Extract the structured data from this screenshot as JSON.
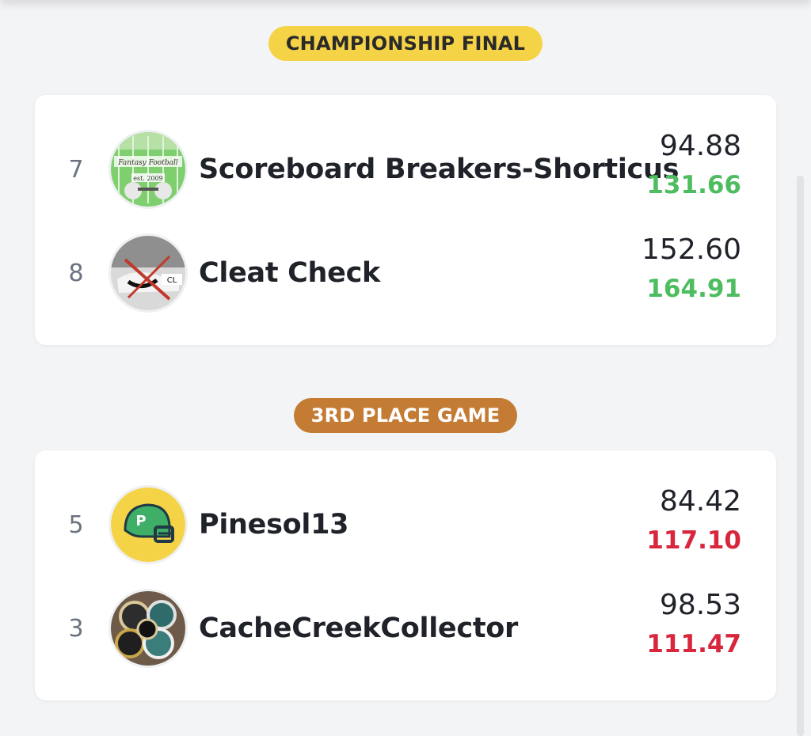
{
  "colors": {
    "background": "#f3f4f6",
    "championship_pill": "#f5d347",
    "third_place_pill": "#c47c35",
    "win_score": "#4dbd5f",
    "loss_score": "#d8263d"
  },
  "championship": {
    "label": "CHAMPIONSHIP FINAL",
    "teams": [
      {
        "seed": "7",
        "name": "Scoreboard Breakers-Shorticus",
        "score_top": "94.88",
        "score_bottom": "131.66",
        "result": "win",
        "avatar_icon": "league-logo-avatar",
        "avatar_text": "est. 2009"
      },
      {
        "seed": "8",
        "name": "Cleat Check",
        "score_top": "152.60",
        "score_bottom": "164.91",
        "result": "win",
        "avatar_icon": "cleat-photo-avatar",
        "avatar_text": "CL"
      }
    ]
  },
  "third_place": {
    "label": "3RD PLACE GAME",
    "teams": [
      {
        "seed": "5",
        "name": "Pinesol13",
        "score_top": "84.42",
        "score_bottom": "117.10",
        "result": "loss",
        "avatar_icon": "football-helmet-avatar",
        "avatar_text": "P"
      },
      {
        "seed": "3",
        "name": "CacheCreekCollector",
        "score_top": "98.53",
        "score_bottom": "111.47",
        "result": "loss",
        "avatar_icon": "poker-chips-avatar"
      }
    ]
  }
}
